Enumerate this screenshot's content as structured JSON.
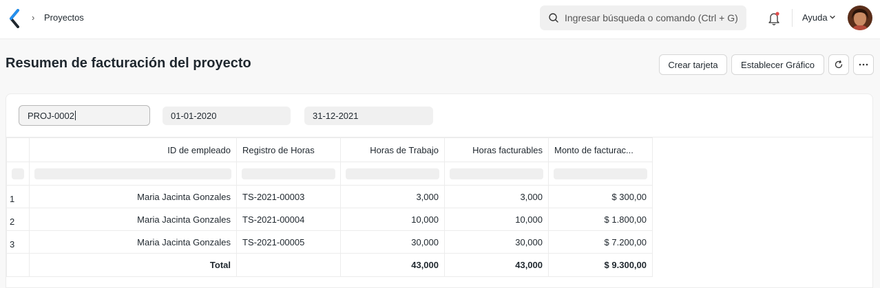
{
  "navbar": {
    "breadcrumb": "Proyectos",
    "search_placeholder": "Ingresar búsqueda o comando (Ctrl + G)",
    "help_label": "Ayuda"
  },
  "page": {
    "title": "Resumen de facturación del proyecto",
    "buttons": {
      "create_card": "Crear tarjeta",
      "set_chart": "Establecer Gráfico"
    }
  },
  "filters": {
    "project": "PROJ-0002",
    "from_date": "01-01-2020",
    "to_date": "31-12-2021"
  },
  "table": {
    "columns": [
      "ID de empleado",
      "Registro de Horas",
      "Horas de Trabajo",
      "Horas facturables",
      "Monto de facturac..."
    ],
    "rows": [
      {
        "num": "1",
        "employee": "Maria Jacinta Gonzales",
        "timesheet": "TS-2021-00003",
        "working_hours": "3,000",
        "billable_hours": "3,000",
        "amount": "$ 300,00"
      },
      {
        "num": "2",
        "employee": "Maria Jacinta Gonzales",
        "timesheet": "TS-2021-00004",
        "working_hours": "10,000",
        "billable_hours": "10,000",
        "amount": "$ 1.800,00"
      },
      {
        "num": "3",
        "employee": "Maria Jacinta Gonzales",
        "timesheet": "TS-2021-00005",
        "working_hours": "30,000",
        "billable_hours": "30,000",
        "amount": "$ 7.200,00"
      }
    ],
    "total": {
      "label": "Total",
      "working_hours": "43,000",
      "billable_hours": "43,000",
      "amount": "$ 9.300,00"
    }
  },
  "colors": {
    "text": "#1f272e",
    "border": "#ececec",
    "input_bg": "#f0f0f0",
    "logo": "#2490ef"
  }
}
